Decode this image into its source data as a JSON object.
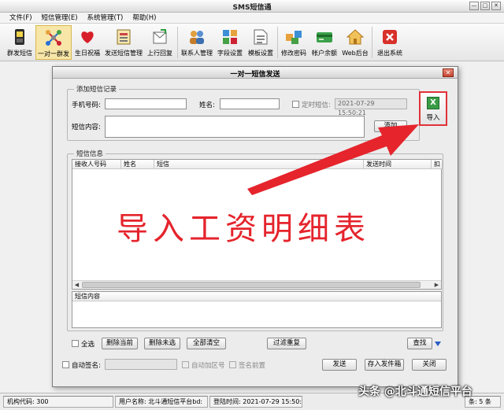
{
  "window": {
    "title": "SMS短信通",
    "min": "—",
    "max": "□",
    "close": "✕"
  },
  "menu": [
    "文件(F)",
    "短信管理(E)",
    "系统管理(T)",
    "帮助(H)"
  ],
  "toolbar": [
    {
      "label": "群发短信",
      "icon": "phone-icon"
    },
    {
      "label": "一对一群发",
      "icon": "network-icon"
    },
    {
      "label": "生日祝福",
      "icon": "heart-icon"
    },
    {
      "label": "发送短信管理",
      "icon": "sms-manage-icon"
    },
    {
      "label": "上行回复",
      "icon": "reply-icon"
    },
    {
      "label": "联系人管理",
      "icon": "contacts-icon"
    },
    {
      "label": "字段设置",
      "icon": "fields-icon"
    },
    {
      "label": "模板设置",
      "icon": "template-icon"
    },
    {
      "label": "修改密码",
      "icon": "password-icon"
    },
    {
      "label": "帐户余额",
      "icon": "balance-icon"
    },
    {
      "label": "Web后台",
      "icon": "home-icon"
    },
    {
      "label": "退出系统",
      "icon": "exit-icon"
    }
  ],
  "dialog": {
    "title": "一对一短信发送",
    "add_group": {
      "legend": "添加短信记录",
      "phone_label": "手机号码:",
      "name_label": "姓名:",
      "timed_label": "定时短信:",
      "timed_value": "2021-07-29 15:50:21",
      "content_label": "短信内容:",
      "add_button": "添加",
      "import_button": "导入"
    },
    "info_group": {
      "legend": "短信信息",
      "columns": [
        "接收人号码",
        "姓名",
        "短信",
        "发送时间",
        "扣"
      ],
      "content_header": "短信内容"
    },
    "actions": {
      "select_all": "全选",
      "delete_current": "删除当前",
      "delete_unselected": "删除未选",
      "clear_all": "全部清空",
      "filter_duplicates": "过滤重复",
      "search": "查找"
    },
    "bottom": {
      "auto_sign": "自动签名:",
      "auto_prefix": "自动加区号",
      "sign_front": "签名前置",
      "send": "发送",
      "save_outbox": "存入发件箱",
      "close": "关闭"
    }
  },
  "statusbar": {
    "org_code": "机构代码:  300",
    "user_name": "用户名称:  北斗通短信平台bd:",
    "login_time": "登陆时间:  2021-07-29  15:50:19",
    "extra": "条: 5 条"
  },
  "annotation": {
    "text": "导入工资明细表",
    "color": "#e5242c"
  },
  "watermark": "头条 @北斗通短信平台"
}
